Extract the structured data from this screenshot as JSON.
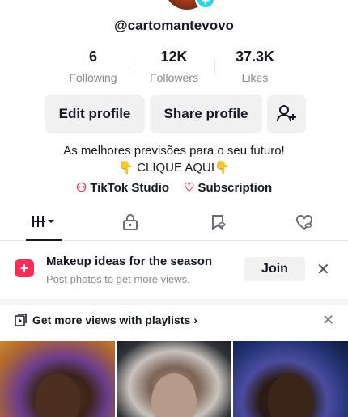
{
  "profile": {
    "username": "@cartomantevovo",
    "stats": [
      {
        "value": "6",
        "label": "Following"
      },
      {
        "value": "12K",
        "label": "Followers"
      },
      {
        "value": "37.3K",
        "label": "Likes"
      }
    ],
    "edit_label": "Edit profile",
    "share_label": "Share profile",
    "bio_line1": "As melhores previsões para o seu futuro!",
    "bio_line2": "👇 CLIQUE AQUI👇",
    "link_studio": "TikTok Studio",
    "link_subscription": "Subscription"
  },
  "promo": {
    "title": "Makeup ideas for the season",
    "subtitle": "Post photos to get more views.",
    "join_label": "Join"
  },
  "playlist": {
    "label": "Get more views with playlists"
  },
  "colors": {
    "accent": "#fe2c55",
    "teal": "#20d5ec",
    "gray_button": "#f1f1f2"
  }
}
